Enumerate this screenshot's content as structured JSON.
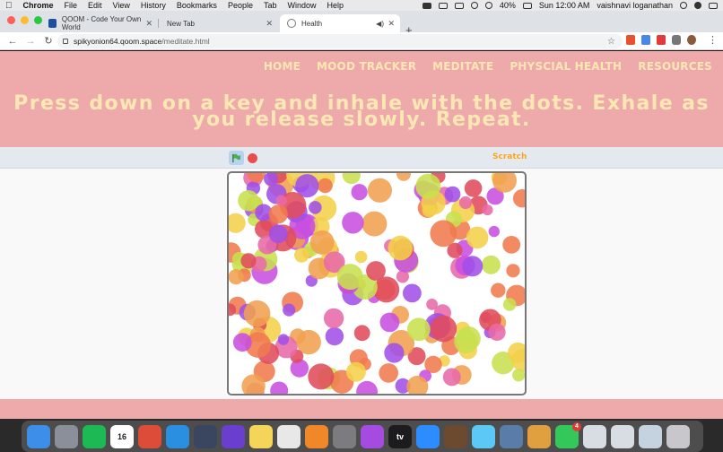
{
  "menubar": {
    "items": [
      "Chrome",
      "File",
      "Edit",
      "View",
      "History",
      "Bookmarks",
      "People",
      "Tab",
      "Window",
      "Help"
    ],
    "battery": "40%",
    "clock": "Sun 12:00 AM",
    "user": "vaishnavi loganathan"
  },
  "tabs": [
    {
      "title": "QOOM - Code Your Own World",
      "favicon_color": "#1e4fa0"
    },
    {
      "title": "New Tab",
      "favicon_color": "#dee1e6"
    },
    {
      "title": "Health",
      "favicon_color": "#888888"
    }
  ],
  "browser": {
    "url_host": "spikyonion64.qoom.space",
    "url_path": "/meditate.html"
  },
  "site": {
    "nav": [
      "HOME",
      "MOOD TRACKER",
      "MEDITATE",
      "PHYSCIAL HEALTH",
      "RESOURCES"
    ],
    "headline_line1": "Press down on a key and inhale with the dots. Exhale as",
    "headline_line2": "you release slowly. Repeat.",
    "hero_color": "#eeaaaa",
    "text_color": "#fbe7b4"
  },
  "scratch": {
    "logo": "Scratch",
    "flag_icon": "green-flag-icon",
    "stop_icon": "stop-sign-icon",
    "dot_colors": [
      "#e04c5c",
      "#c84fe0",
      "#a050e8",
      "#f07a4e",
      "#f2d04a",
      "#c8e04e",
      "#e86aa8",
      "#f0a050"
    ]
  },
  "dock": {
    "apps": [
      {
        "name": "finder-icon",
        "color": "#3d8ee8",
        "label": ""
      },
      {
        "name": "launchpad-icon",
        "color": "#8a8f99",
        "label": ""
      },
      {
        "name": "spotify-icon",
        "color": "#1db954",
        "label": ""
      },
      {
        "name": "calendar-icon",
        "color": "#ffffff",
        "label": "16"
      },
      {
        "name": "chrome-icon",
        "color": "#dd4b39",
        "label": ""
      },
      {
        "name": "safari-icon",
        "color": "#2a8fe0",
        "label": ""
      },
      {
        "name": "quicktime-icon",
        "color": "#3a4660",
        "label": ""
      },
      {
        "name": "imovie-icon",
        "color": "#6a3fd0",
        "label": ""
      },
      {
        "name": "notes-icon",
        "color": "#f5d45a",
        "label": ""
      },
      {
        "name": "textedit-icon",
        "color": "#e8e8e8",
        "label": ""
      },
      {
        "name": "books-icon",
        "color": "#f0882a",
        "label": ""
      },
      {
        "name": "system-preferences-icon",
        "color": "#7c7c80",
        "label": ""
      },
      {
        "name": "podcasts-icon",
        "color": "#a54be0",
        "label": ""
      },
      {
        "name": "apple-tv-icon",
        "color": "#1c1c1e",
        "label": "tv"
      },
      {
        "name": "zoom-icon",
        "color": "#2d8cff",
        "label": ""
      },
      {
        "name": "instruments-icon",
        "color": "#6b4a2f",
        "label": ""
      },
      {
        "name": "messages-icon",
        "color": "#5bc8f5",
        "label": ""
      },
      {
        "name": "preview-icon",
        "color": "#5a7ca8",
        "label": ""
      },
      {
        "name": "archive-icon",
        "color": "#e0a040",
        "label": ""
      },
      {
        "name": "facetime-icon",
        "color": "#34c759",
        "label": "",
        "badge": "4"
      },
      {
        "name": "window-icon",
        "color": "#d8dde3",
        "label": ""
      },
      {
        "name": "window-icon-2",
        "color": "#d8dde3",
        "label": ""
      },
      {
        "name": "downloads-icon",
        "color": "#c5d3e0",
        "label": ""
      },
      {
        "name": "trash-icon",
        "color": "#c8c8cc",
        "label": ""
      }
    ]
  }
}
